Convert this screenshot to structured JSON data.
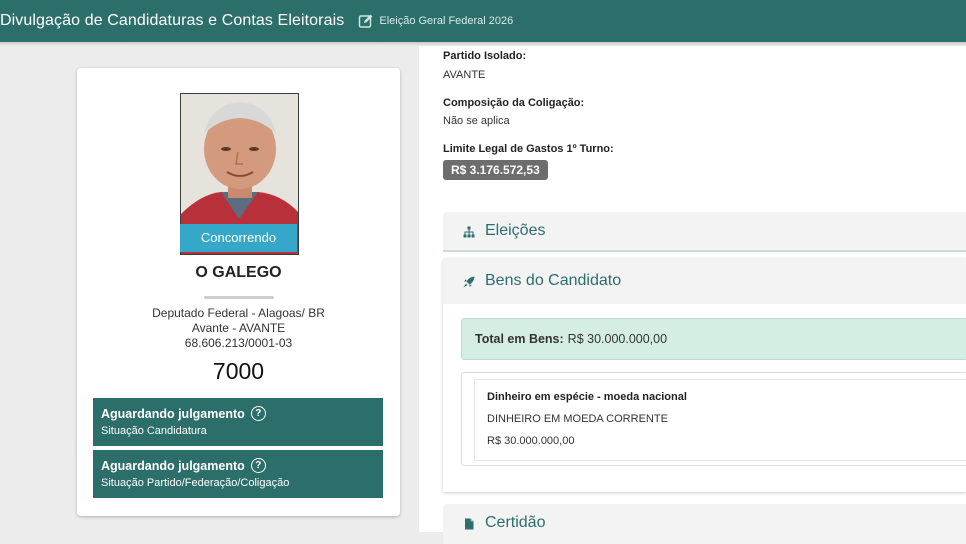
{
  "header": {
    "title": "Divulgação de Candidaturas e Contas Eleitorais",
    "election": "Eleição Geral Federal 2026",
    "edit_icon": "edit-icon"
  },
  "candidate": {
    "status_badge": "Concorrendo",
    "name": "O GALEGO",
    "office": "Deputado Federal - Alagoas/ BR",
    "party": "Avante - AVANTE",
    "cnpj": "68.606.213/0001-03",
    "number": "7000",
    "statuses": [
      {
        "title": "Aguardando julgamento",
        "subtitle": "Situação Candidatura"
      },
      {
        "title": "Aguardando julgamento",
        "subtitle": "Situação Partido/Federação/Coligação"
      }
    ]
  },
  "details": {
    "party_label": "Partido Isolado:",
    "party_value": "AVANTE",
    "coalition_label": "Composição da Coligação:",
    "coalition_value": "Não se aplica",
    "limit_label": "Limite Legal de Gastos 1º Turno:",
    "limit_value": "R$ 3.176.572,53"
  },
  "sections": {
    "elections": "Eleições",
    "assets": "Bens do Candidato",
    "certificate": "Certidão"
  },
  "assets": {
    "total_label": "Total em Bens:",
    "total_value": "R$ 30.000.000,00",
    "items": [
      {
        "type": "Dinheiro em espécie - moeda nacional",
        "description": "DINHEIRO EM MOEDA CORRENTE",
        "value": "R$ 30.000.000,00"
      }
    ]
  },
  "colors": {
    "primary": "#2b6e6a",
    "running_badge": "#35a7c9",
    "total_bg": "#d5eee3"
  }
}
